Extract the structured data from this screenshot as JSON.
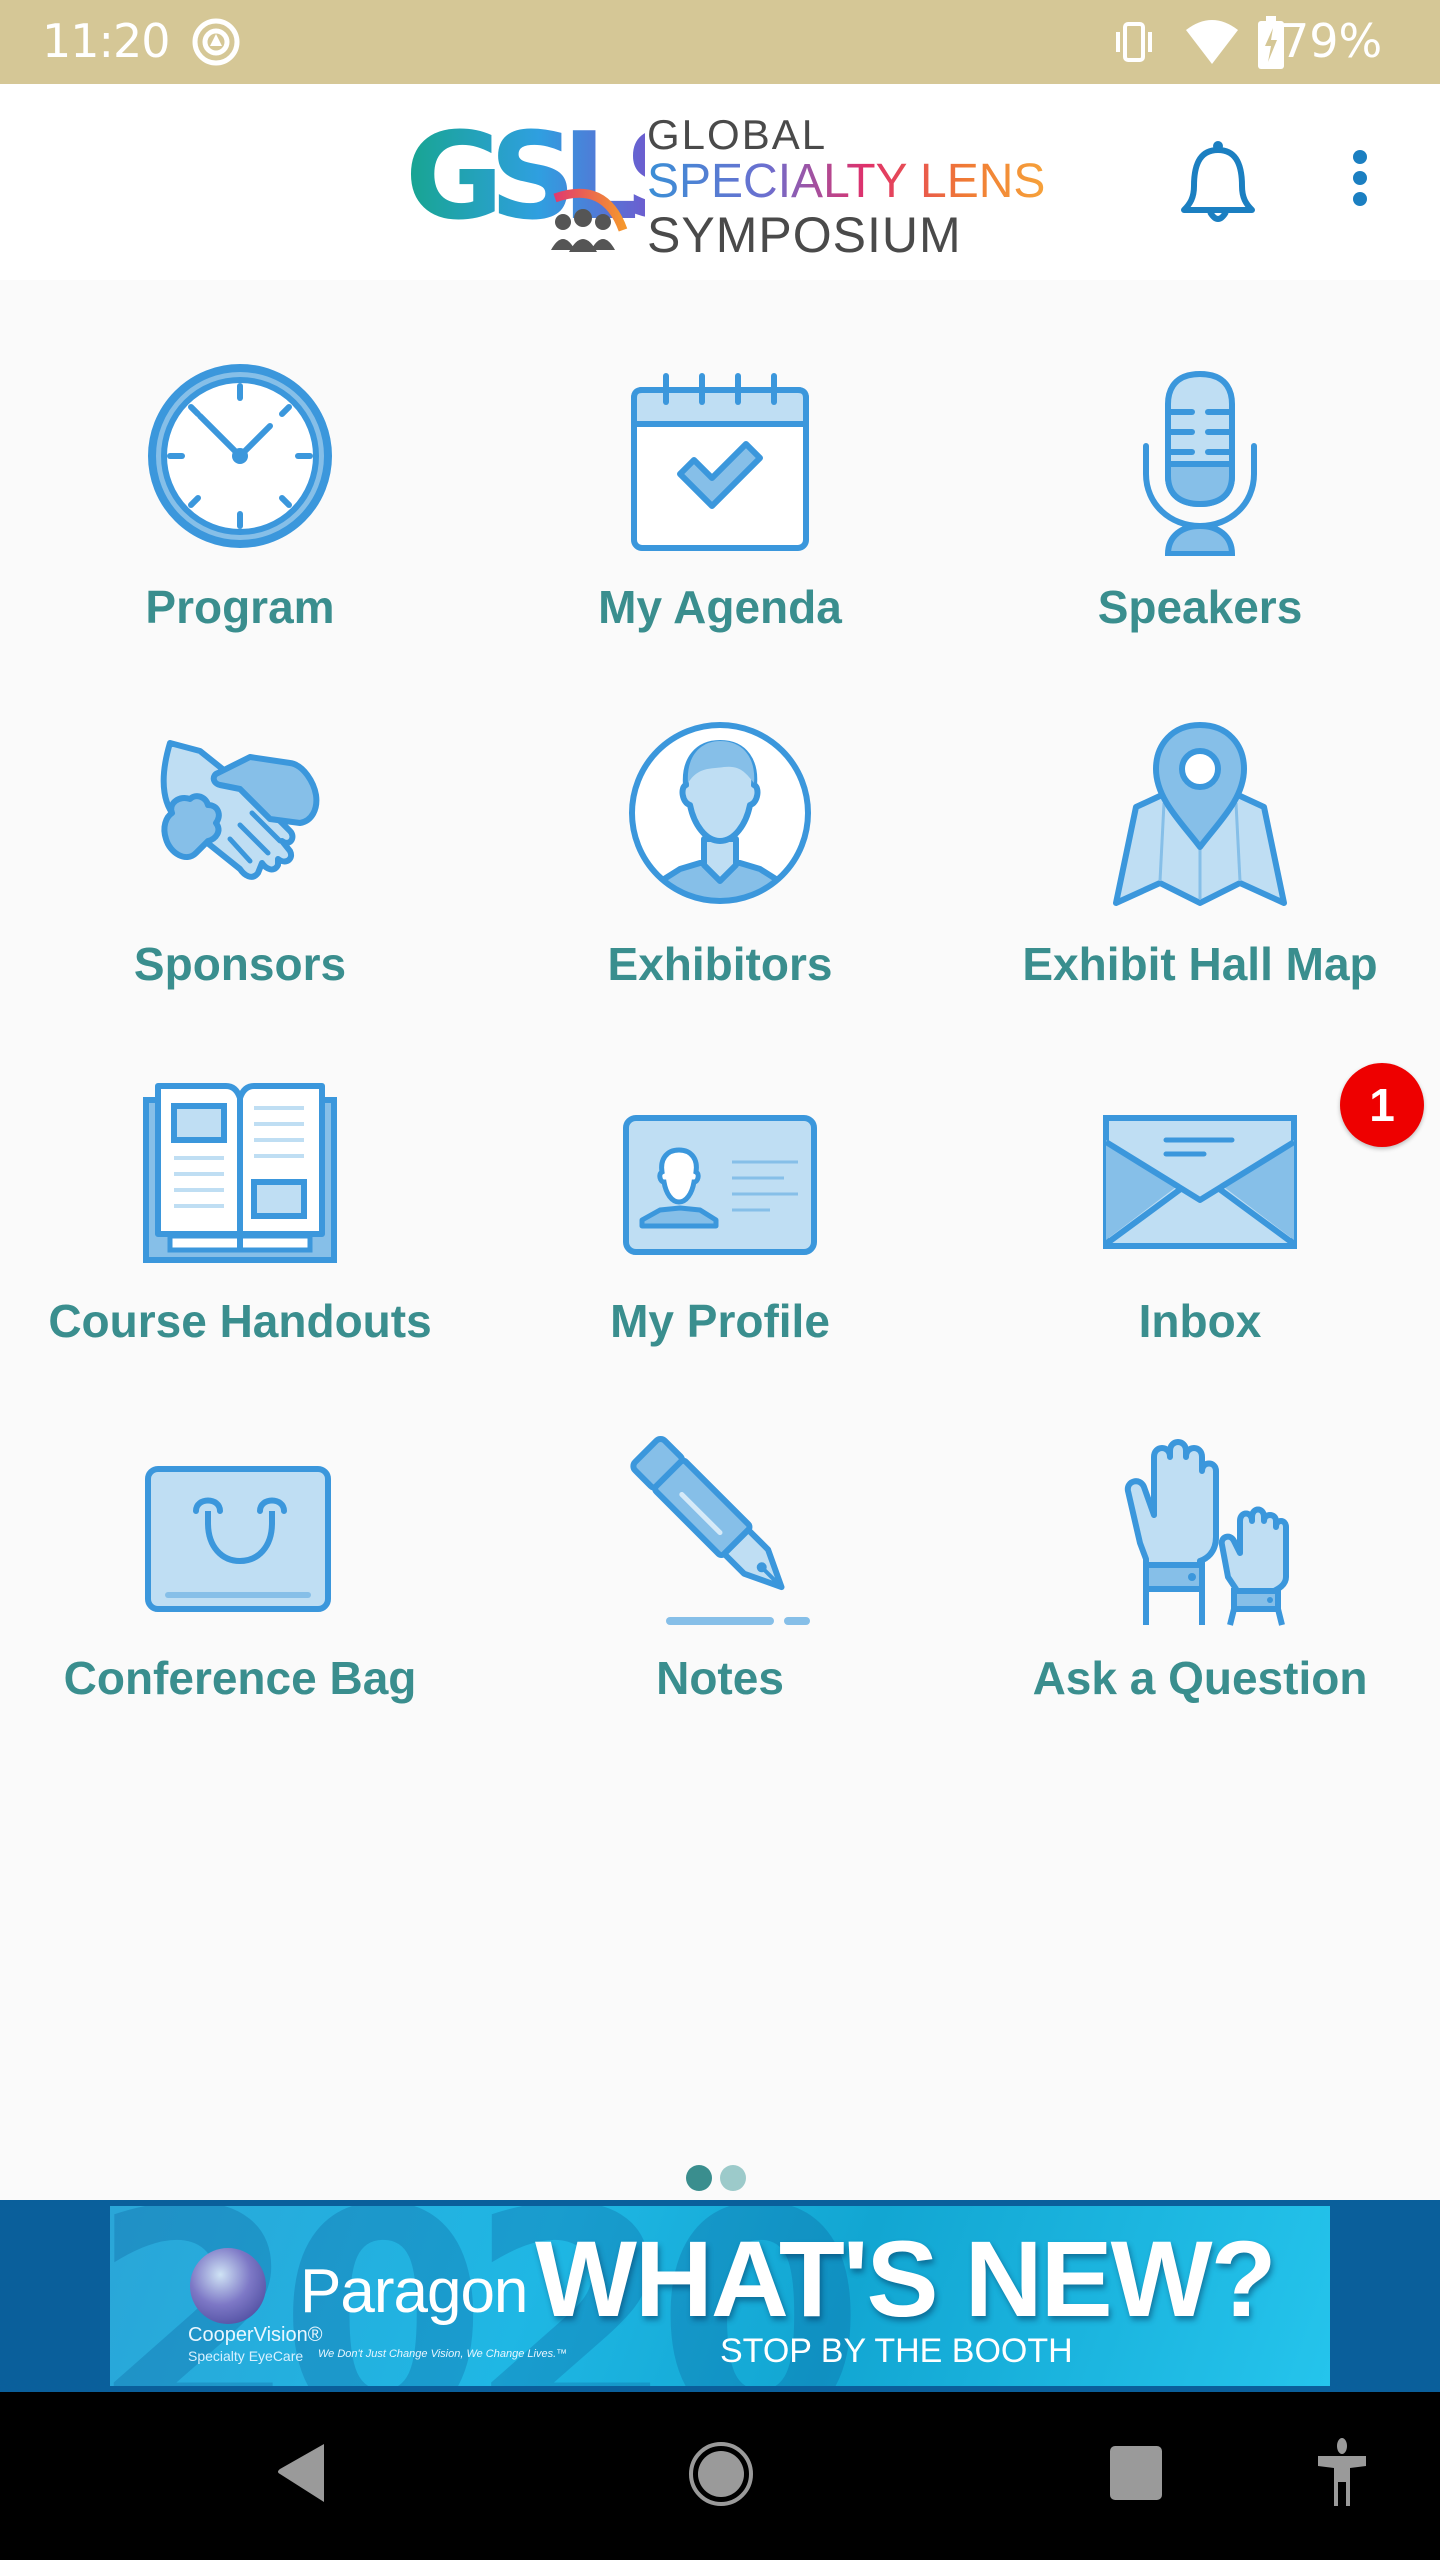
{
  "status_bar": {
    "time": "11:20",
    "notification_icon": "at-sign-icon",
    "icons": [
      "vibrate-icon",
      "wifi-icon",
      "battery-charging-icon"
    ],
    "battery_percent": "79%"
  },
  "app_bar": {
    "logo": {
      "mark": "GSLS",
      "line1": "GLOBAL",
      "line2": "SPECIALTY LENS",
      "line3": "SYMPOSIUM"
    },
    "actions": [
      {
        "name": "notifications",
        "icon": "bell-icon"
      },
      {
        "name": "more-options",
        "icon": "more-vert-icon"
      }
    ]
  },
  "menu": {
    "items": [
      {
        "label": "Program",
        "icon": "clock-icon"
      },
      {
        "label": "My Agenda",
        "icon": "calendar-check-icon"
      },
      {
        "label": "Speakers",
        "icon": "microphone-icon"
      },
      {
        "label": "Sponsors",
        "icon": "handshake-icon"
      },
      {
        "label": "Exhibitors",
        "icon": "person-avatar-icon"
      },
      {
        "label": "Exhibit Hall Map",
        "icon": "map-pin-icon"
      },
      {
        "label": "Course Handouts",
        "icon": "open-book-icon"
      },
      {
        "label": "My Profile",
        "icon": "id-card-icon"
      },
      {
        "label": "Inbox",
        "icon": "envelope-icon",
        "badge": "1"
      },
      {
        "label": "Conference Bag",
        "icon": "shopping-bag-icon"
      },
      {
        "label": "Notes",
        "icon": "fountain-pen-icon"
      },
      {
        "label": "Ask a Question",
        "icon": "raised-hands-icon"
      }
    ]
  },
  "pager": {
    "pages": 2,
    "current": 1
  },
  "banner": {
    "bg_text": "2020",
    "brand_small_1": "CooperVision®",
    "brand_small_2": "Specialty EyeCare",
    "brand": "Paragon",
    "tagline": "We Don't Just Change Vision, We Change Lives.™",
    "headline": "WHAT'S NEW?",
    "subline": "STOP BY THE BOOTH"
  },
  "nav_bar": {
    "buttons": [
      "back",
      "home",
      "recents",
      "accessibility"
    ]
  },
  "colors": {
    "status_bar": "#d5c796",
    "label_teal": "#3a8e8e",
    "icon_blue": "#3b97dc",
    "icon_fill_light": "#bfdef3",
    "icon_fill_mid": "#86bfe8",
    "badge_red": "#ee0000",
    "action_blue": "#1b7fc1"
  }
}
